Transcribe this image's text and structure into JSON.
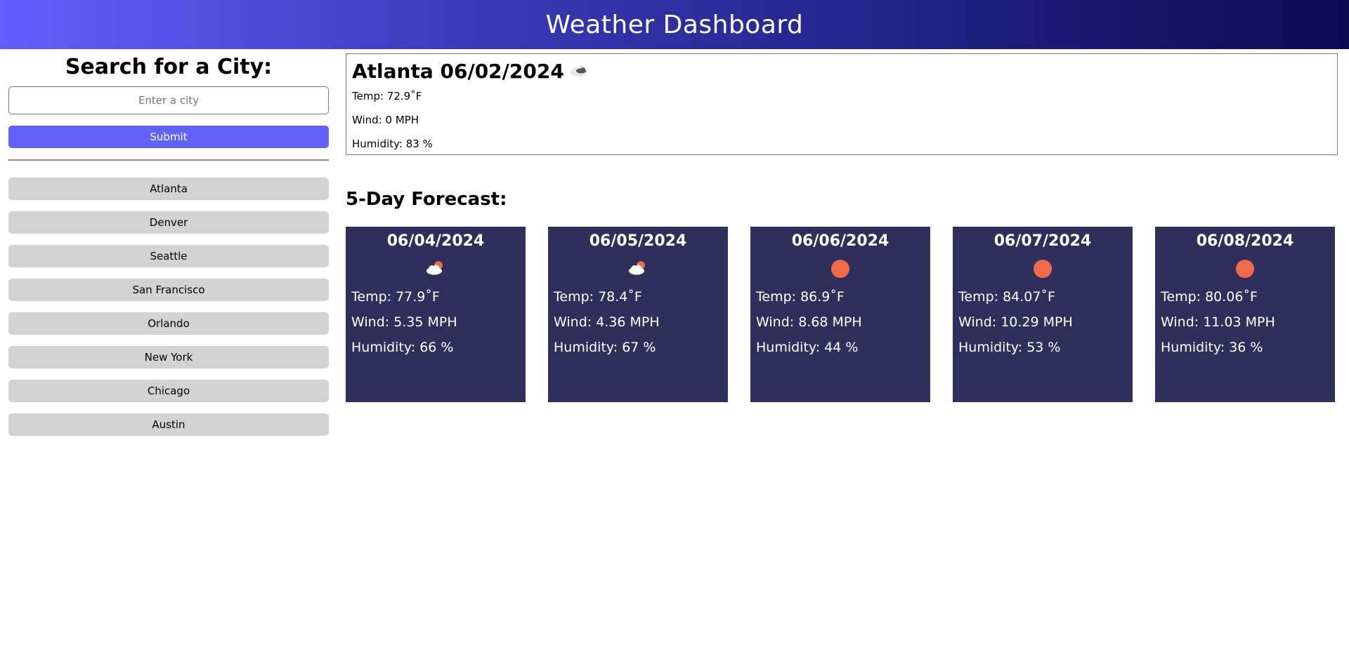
{
  "header": {
    "title": "Weather Dashboard"
  },
  "search": {
    "heading": "Search for a City:",
    "placeholder": "Enter a city",
    "submit_label": "Submit"
  },
  "history": [
    "Atlanta",
    "Denver",
    "Seattle",
    "San Francisco",
    "Orlando",
    "New York",
    "Chicago",
    "Austin"
  ],
  "current": {
    "title": "Atlanta 06/02/2024",
    "icon": "cloud-icon",
    "temp": "Temp: 72.9˚F",
    "wind": "Wind: 0 MPH",
    "humidity": "Humidity: 83 %"
  },
  "forecast": {
    "heading": "5-Day Forecast:",
    "days": [
      {
        "date": "06/04/2024",
        "icon": "partly-cloudy-icon",
        "temp": "Temp: 77.9˚F",
        "wind": "Wind: 5.35 MPH",
        "humidity": "Humidity: 66 %"
      },
      {
        "date": "06/05/2024",
        "icon": "partly-cloudy-icon",
        "temp": "Temp: 78.4˚F",
        "wind": "Wind: 4.36 MPH",
        "humidity": "Humidity: 67 %"
      },
      {
        "date": "06/06/2024",
        "icon": "sun-icon",
        "temp": "Temp: 86.9˚F",
        "wind": "Wind: 8.68 MPH",
        "humidity": "Humidity: 44 %"
      },
      {
        "date": "06/07/2024",
        "icon": "sun-icon",
        "temp": "Temp: 84.07˚F",
        "wind": "Wind: 10.29 MPH",
        "humidity": "Humidity: 53 %"
      },
      {
        "date": "06/08/2024",
        "icon": "sun-icon",
        "temp": "Temp: 80.06˚F",
        "wind": "Wind: 11.03 MPH",
        "humidity": "Humidity: 36 %"
      }
    ]
  },
  "colors": {
    "header_start": "#6161ff",
    "header_end": "#0b0b52",
    "submit": "#6262f7",
    "history_button": "#d3d3d3",
    "card_bg": "#302f5c",
    "sun": "#f06a4a"
  }
}
